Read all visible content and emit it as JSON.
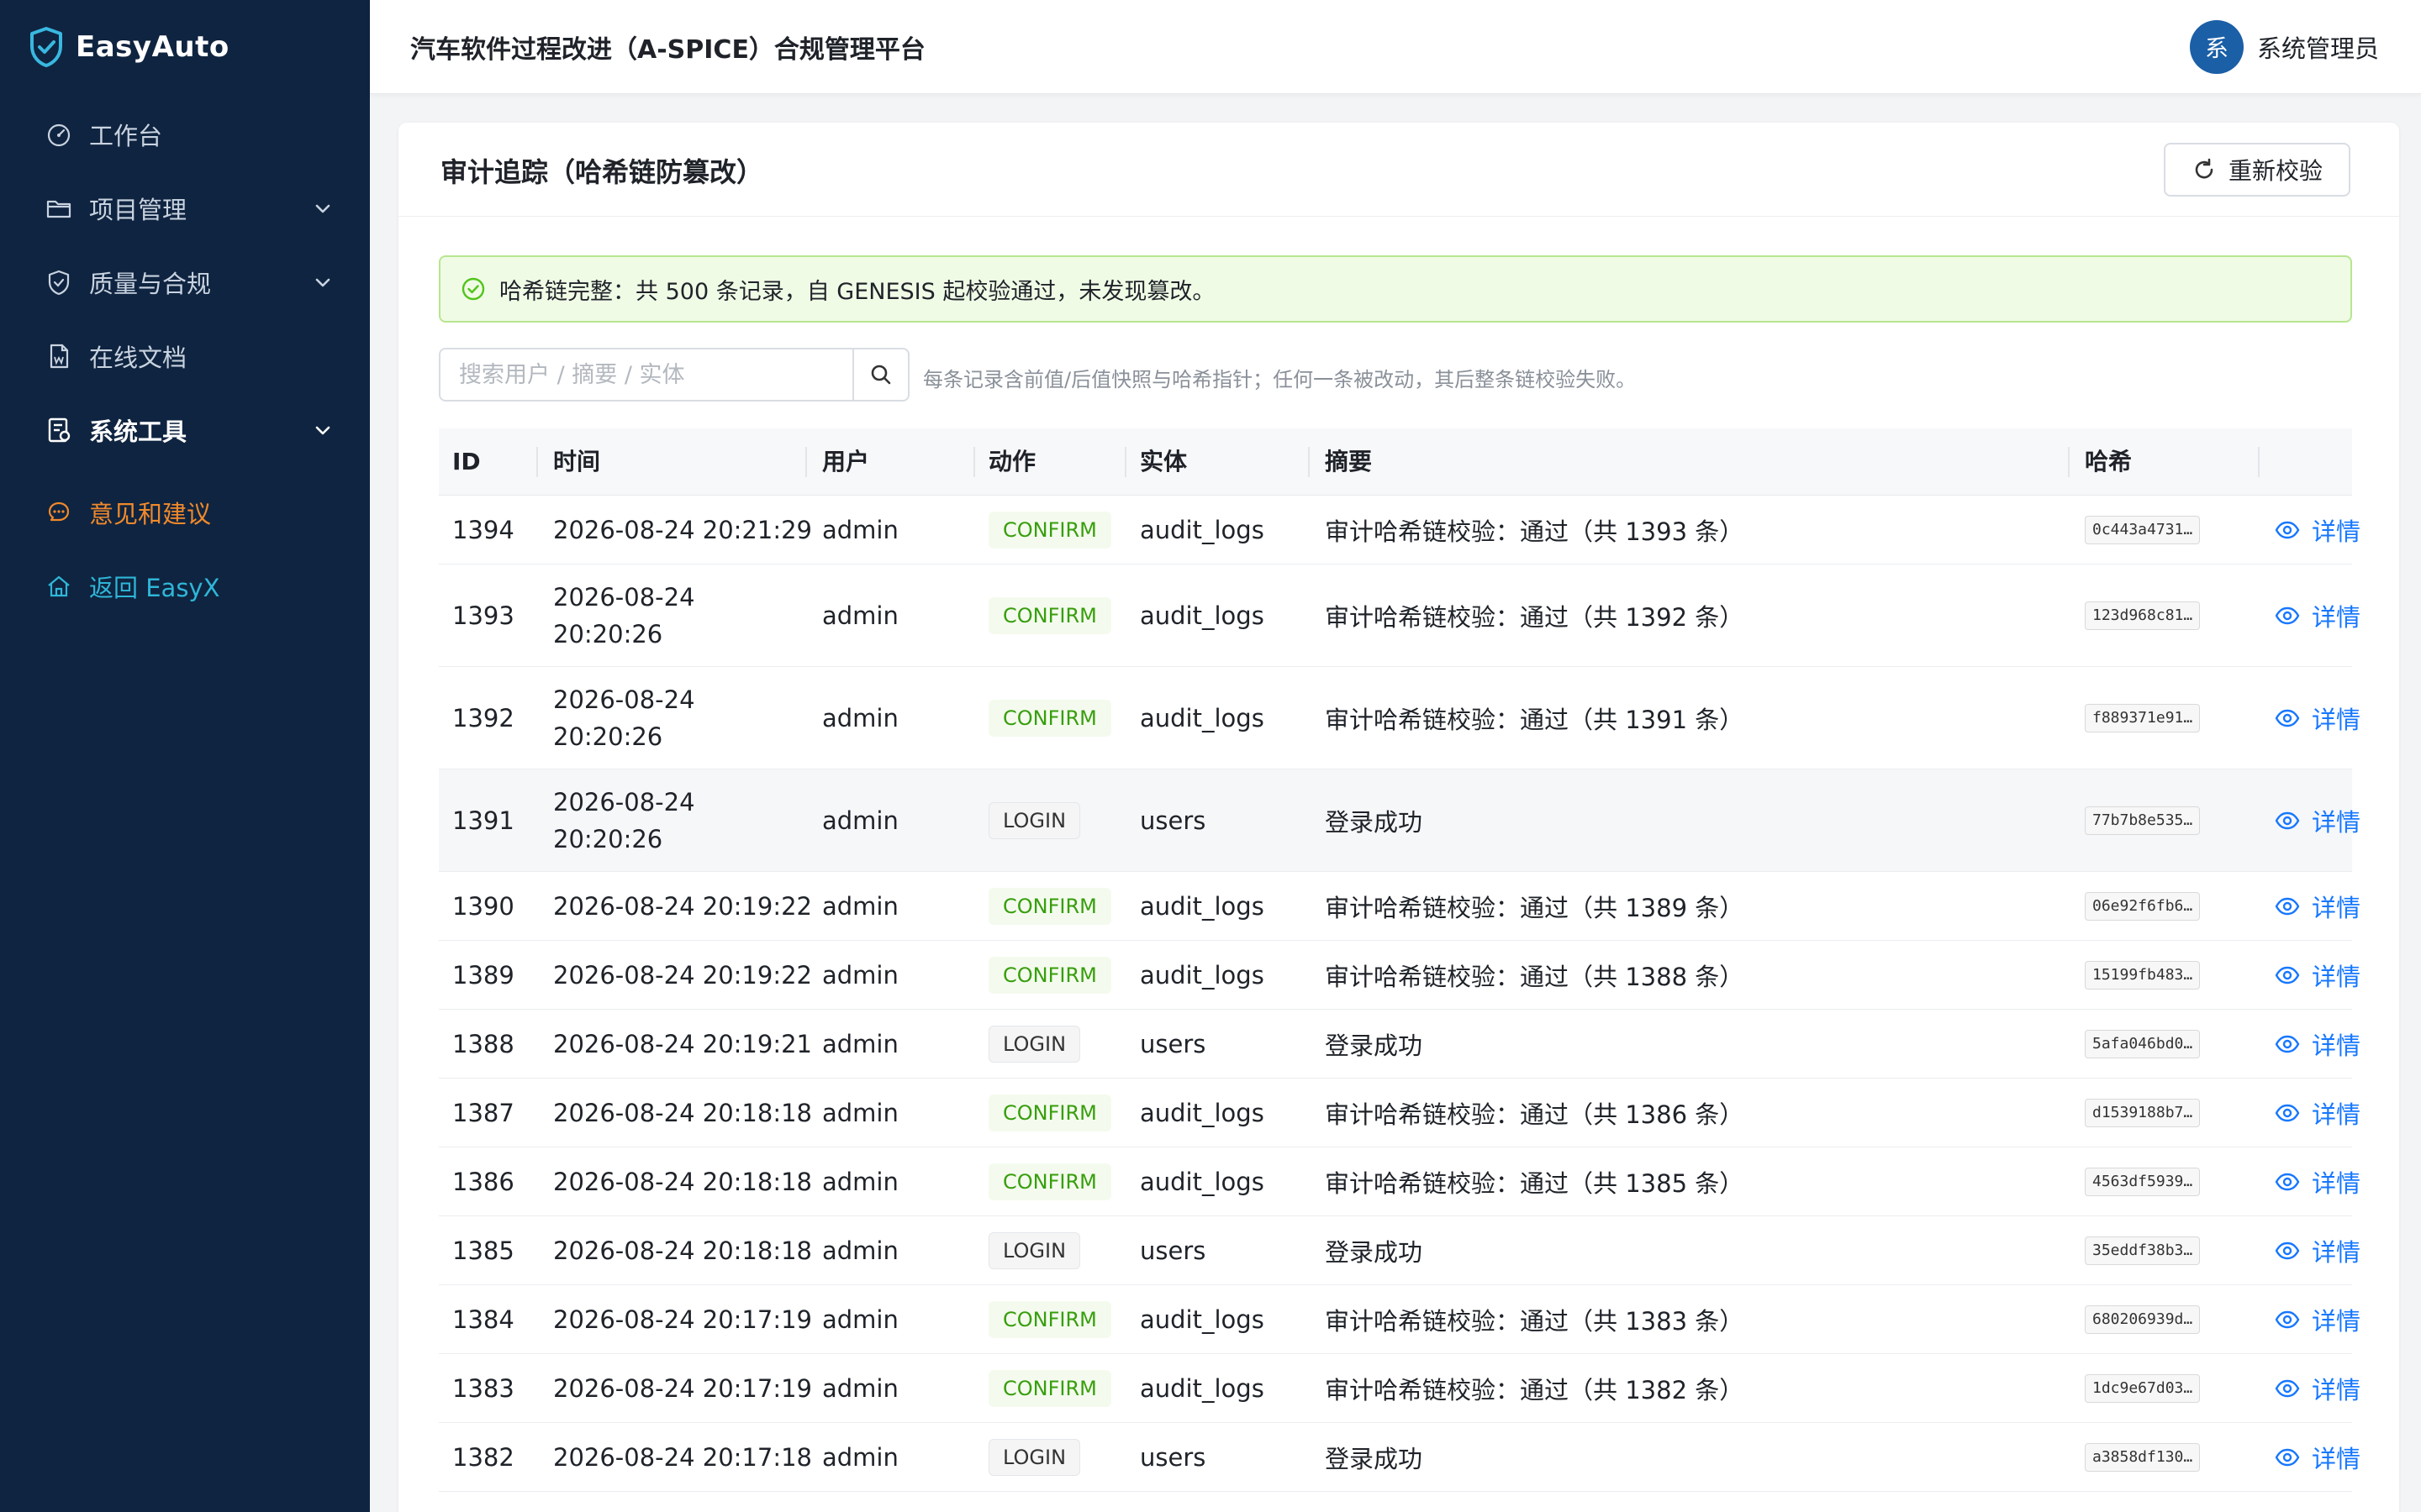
{
  "sidebar": {
    "brand": "EasyAuto",
    "items": [
      {
        "label": "工作台",
        "icon": "dashboard-icon"
      },
      {
        "label": "项目管理",
        "icon": "folder-icon"
      },
      {
        "label": "质量与合规",
        "icon": "shield-check-icon"
      },
      {
        "label": "在线文档",
        "icon": "document-icon"
      },
      {
        "label": "系统工具",
        "icon": "tools-icon"
      },
      {
        "label": "意见和建议",
        "icon": "chat-icon"
      },
      {
        "label": "返回 EasyX",
        "icon": "home-icon"
      }
    ]
  },
  "header": {
    "title": "汽车软件过程改进（A-SPICE）合规管理平台",
    "avatar_text": "系",
    "user_name": "系统管理员"
  },
  "card": {
    "title": "审计追踪（哈希链防篡改）",
    "recheck_label": "重新校验",
    "alert": "哈希链完整：共 500 条记录，自 GENESIS 起校验通过，未发现篡改。",
    "search_placeholder": "搜索用户 / 摘要 / 实体",
    "hint": "每条记录含前值/后值快照与哈希指针；任何一条被改动，其后整条链校验失败。"
  },
  "table": {
    "columns": [
      "ID",
      "时间",
      "用户",
      "动作",
      "实体",
      "摘要",
      "哈希"
    ],
    "detail_label": "详情",
    "rows": [
      {
        "id": "1394",
        "time": "2026-08-24 20:21:29",
        "user": "admin",
        "action": "CONFIRM",
        "entity": "audit_logs",
        "summary": "审计哈希链校验：通过（共 1393 条）",
        "hash": "0c443a4731…"
      },
      {
        "id": "1393",
        "time": "2026-08-24 20:20:26",
        "user": "admin",
        "action": "CONFIRM",
        "entity": "audit_logs",
        "summary": "审计哈希链校验：通过（共 1392 条）",
        "hash": "123d968c81…"
      },
      {
        "id": "1392",
        "time": "2026-08-24 20:20:26",
        "user": "admin",
        "action": "CONFIRM",
        "entity": "audit_logs",
        "summary": "审计哈希链校验：通过（共 1391 条）",
        "hash": "f889371e91…"
      },
      {
        "id": "1391",
        "time": "2026-08-24 20:20:26",
        "user": "admin",
        "action": "LOGIN",
        "entity": "users",
        "summary": "登录成功",
        "hash": "77b7b8e535…"
      },
      {
        "id": "1390",
        "time": "2026-08-24 20:19:22",
        "user": "admin",
        "action": "CONFIRM",
        "entity": "audit_logs",
        "summary": "审计哈希链校验：通过（共 1389 条）",
        "hash": "06e92f6fb6…"
      },
      {
        "id": "1389",
        "time": "2026-08-24 20:19:22",
        "user": "admin",
        "action": "CONFIRM",
        "entity": "audit_logs",
        "summary": "审计哈希链校验：通过（共 1388 条）",
        "hash": "15199fb483…"
      },
      {
        "id": "1388",
        "time": "2026-08-24 20:19:21",
        "user": "admin",
        "action": "LOGIN",
        "entity": "users",
        "summary": "登录成功",
        "hash": "5afa046bd0…"
      },
      {
        "id": "1387",
        "time": "2026-08-24 20:18:18",
        "user": "admin",
        "action": "CONFIRM",
        "entity": "audit_logs",
        "summary": "审计哈希链校验：通过（共 1386 条）",
        "hash": "d1539188b7…"
      },
      {
        "id": "1386",
        "time": "2026-08-24 20:18:18",
        "user": "admin",
        "action": "CONFIRM",
        "entity": "audit_logs",
        "summary": "审计哈希链校验：通过（共 1385 条）",
        "hash": "4563df5939…"
      },
      {
        "id": "1385",
        "time": "2026-08-24 20:18:18",
        "user": "admin",
        "action": "LOGIN",
        "entity": "users",
        "summary": "登录成功",
        "hash": "35eddf38b3…"
      },
      {
        "id": "1384",
        "time": "2026-08-24 20:17:19",
        "user": "admin",
        "action": "CONFIRM",
        "entity": "audit_logs",
        "summary": "审计哈希链校验：通过（共 1383 条）",
        "hash": "680206939d…"
      },
      {
        "id": "1383",
        "time": "2026-08-24 20:17:19",
        "user": "admin",
        "action": "CONFIRM",
        "entity": "audit_logs",
        "summary": "审计哈希链校验：通过（共 1382 条）",
        "hash": "1dc9e67d03…"
      },
      {
        "id": "1382",
        "time": "2026-08-24 20:17:18",
        "user": "admin",
        "action": "LOGIN",
        "entity": "users",
        "summary": "登录成功",
        "hash": "a3858df130…"
      }
    ]
  },
  "colors": {
    "sidebar_bg": "#0f2440",
    "accent_blue": "#1677ff",
    "feedback_orange": "#f0892b",
    "back_teal": "#2fb6d8",
    "confirm_green": "#389e0d",
    "alert_bg": "#f0fbe6"
  }
}
